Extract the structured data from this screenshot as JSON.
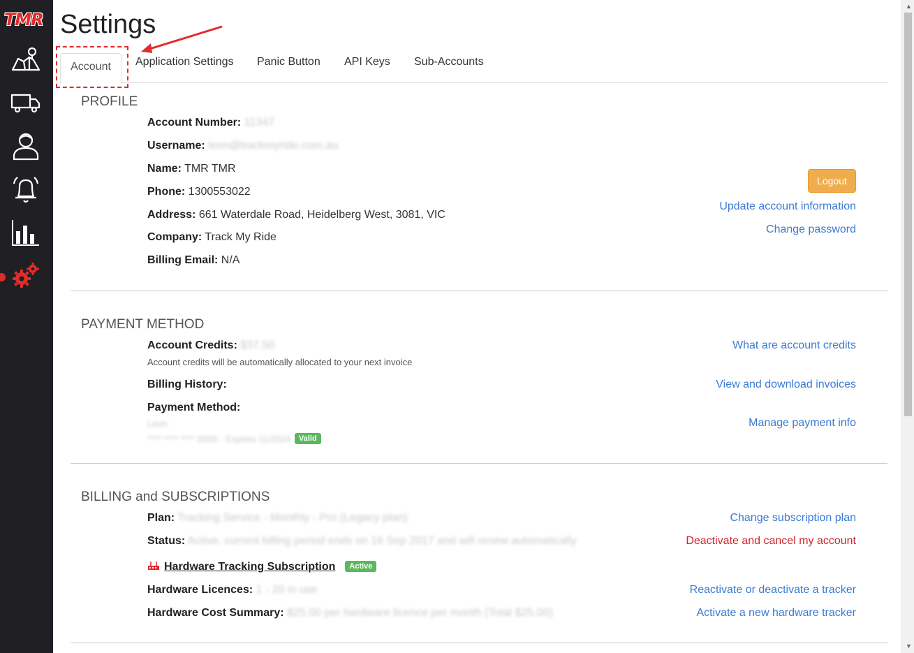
{
  "app": {
    "logo": "TMR"
  },
  "sidebar": {
    "items": [
      {
        "icon": "map-icon"
      },
      {
        "icon": "truck-icon"
      },
      {
        "icon": "user-icon"
      },
      {
        "icon": "bell-icon"
      },
      {
        "icon": "bar-chart-icon"
      },
      {
        "icon": "gears-icon",
        "active": true
      }
    ]
  },
  "page": {
    "title": "Settings"
  },
  "tabs": [
    "Account",
    "Application Settings",
    "Panic Button",
    "API Keys",
    "Sub-Accounts"
  ],
  "profile": {
    "title": "PROFILE",
    "account_number_label": "Account Number:",
    "account_number_value": "11347",
    "username_label": "Username:",
    "username_value": "leon@trackmyride.com.au",
    "name_label": "Name:",
    "name_value": "TMR TMR",
    "phone_label": "Phone:",
    "phone_value": "1300553022",
    "address_label": "Address:",
    "address_value": "661 Waterdale Road, Heidelberg West, 3081, VIC",
    "company_label": "Company:",
    "company_value": "Track My Ride",
    "billing_email_label": "Billing Email:",
    "billing_email_value": "N/A",
    "logout": "Logout",
    "update_link": "Update account information",
    "password_link": "Change password"
  },
  "payment": {
    "title": "PAYMENT METHOD",
    "credits_label": "Account Credits:",
    "credits_value": "$37.50",
    "credits_note": "Account credits will be automatically allocated to your next invoice",
    "credits_link": "What are account credits",
    "history_label": "Billing History:",
    "history_link": "View and download invoices",
    "method_label": "Payment Method:",
    "card_name": "Leon",
    "card_number": "**** **** **** 0000 - Expires 11/2024",
    "card_badge": "Valid",
    "manage_link": "Manage payment info"
  },
  "billing": {
    "title": "BILLING and SUBSCRIPTIONS",
    "plan_label": "Plan:",
    "plan_value": "Tracking Service - Monthly - Pro (Legacy plan)",
    "plan_link": "Change subscription plan",
    "status_label": "Status:",
    "status_value": "Active, current billing period ends on 16 Sep 2017 and will renew automatically",
    "status_link": "Deactivate and cancel my account",
    "hw_title": "Hardware Tracking Subscription",
    "hw_badge": "Active",
    "licences_label": "Hardware Licences:",
    "licences_value": "1 - 20 in use",
    "licences_link": "Reactivate or deactivate a tracker",
    "cost_label": "Hardware Cost Summary:",
    "cost_value": "$25.00 per hardware licence per month (Total $25.00)",
    "cost_link": "Activate a new hardware tracker"
  },
  "colors": {
    "sidebar_bg": "#1f1f24",
    "accent_red": "#e32b2b",
    "link": "#3a7bd5",
    "logout_btn": "#f0ad4e",
    "badge_green": "#5cb85c"
  }
}
